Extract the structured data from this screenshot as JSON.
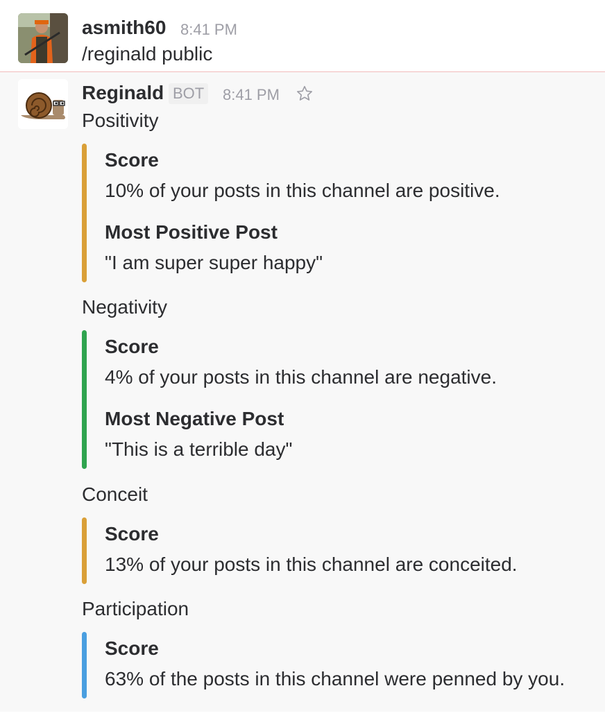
{
  "user_message": {
    "author": "asmith60",
    "time": "8:41 PM",
    "text": "/reginald public"
  },
  "bot_message": {
    "author": "Reginald",
    "badge": "BOT",
    "time": "8:41 PM",
    "sections": [
      {
        "title": "Positivity",
        "color": "#daa038",
        "fields": [
          {
            "title": "Score",
            "value": "10% of your posts in this channel are positive."
          },
          {
            "title": "Most Positive Post",
            "value": "\"I am super super happy\""
          }
        ]
      },
      {
        "title": "Negativity",
        "color": "#2fa44f",
        "fields": [
          {
            "title": "Score",
            "value": "4% of your posts in this channel are negative."
          },
          {
            "title": "Most Negative Post",
            "value": "\"This is a terrible day\""
          }
        ]
      },
      {
        "title": "Conceit",
        "color": "#daa038",
        "fields": [
          {
            "title": "Score",
            "value": "13% of your posts in this channel are conceited."
          }
        ]
      },
      {
        "title": "Participation",
        "color": "#4a9fe0",
        "fields": [
          {
            "title": "Score",
            "value": "63% of the posts in this channel were penned by you."
          }
        ]
      }
    ]
  }
}
